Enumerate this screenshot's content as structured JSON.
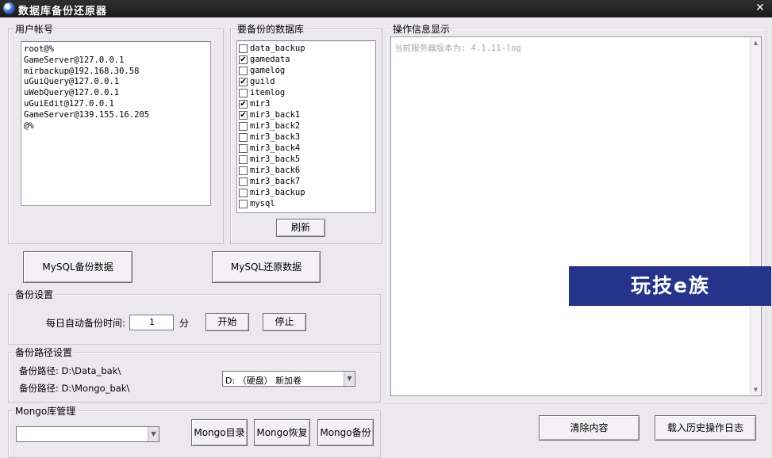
{
  "window": {
    "title": "数据库备份还原器",
    "close_symbol": "✕"
  },
  "user_accounts": {
    "label": "用户帐号",
    "items": [
      "root@%",
      "GameServer@127.0.0.1",
      "mirbackup@192.168.30.58",
      "uGuiQuery@127.0.0.1",
      "uWebQuery@127.0.0.1",
      "uGuiEdit@127.0.0.1",
      "GameServer@139.155.16.205",
      "@%"
    ]
  },
  "databases": {
    "label": "要备份的数据库",
    "items": [
      {
        "name": "data_backup",
        "checked": false
      },
      {
        "name": "gamedata",
        "checked": true
      },
      {
        "name": "gamelog",
        "checked": false
      },
      {
        "name": "guild",
        "checked": true
      },
      {
        "name": "itemlog",
        "checked": false
      },
      {
        "name": "mir3",
        "checked": true
      },
      {
        "name": "mir3_back1",
        "checked": true
      },
      {
        "name": "mir3_back2",
        "checked": false
      },
      {
        "name": "mir3_back3",
        "checked": false
      },
      {
        "name": "mir3_back4",
        "checked": false
      },
      {
        "name": "mir3_back5",
        "checked": false
      },
      {
        "name": "mir3_back6",
        "checked": false
      },
      {
        "name": "mir3_back7",
        "checked": false
      },
      {
        "name": "mir3_backup",
        "checked": false
      },
      {
        "name": "mysql",
        "checked": false
      }
    ],
    "refresh_label": "刷新"
  },
  "actions": {
    "backup_label": "MySQL备份数据",
    "restore_label": "MySQL还原数据"
  },
  "backup_settings": {
    "label": "备份设置",
    "auto_time_label": "每日自动备份时间:",
    "auto_time_value": "1",
    "unit": "分",
    "start_label": "开始",
    "stop_label": "停止"
  },
  "path_settings": {
    "label": "备份路径设置",
    "path1": "备份路径: D:\\Data_bak\\",
    "path2": "备份路径: D:\\Mongo_bak\\",
    "drive_value": "D: （硬盘） 新加卷"
  },
  "mongo": {
    "label": "Mongo库管理",
    "select_value": "",
    "dir_label": "Mongo目录",
    "restore_label": "Mongo恢复",
    "backup_label": "Mongo备份"
  },
  "log_panel": {
    "label": "操作信息显示",
    "lines": [
      "当前服务器版本为: 4.1.11-log"
    ],
    "clear_label": "清除内容",
    "history_label": "载入历史操作日志"
  },
  "watermark": {
    "text": "玩技e族"
  }
}
